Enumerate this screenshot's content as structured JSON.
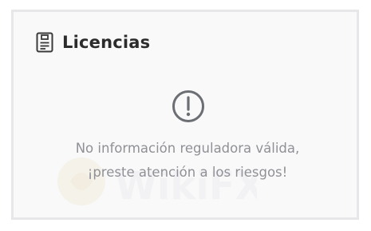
{
  "card": {
    "title": "Licencias",
    "icon": "license-document-icon",
    "alert_icon": "exclamation-circle-icon",
    "message_line1": "No información reguladora válida,",
    "message_line2": "¡preste atención a los riesgos!"
  },
  "watermark": {
    "text": "WikiFX"
  },
  "colors": {
    "card_background": "#f9f9fa",
    "card_border": "#e7e7ea",
    "title_text": "#2c2c2c",
    "message_text": "#8f9196",
    "icon_gray": "#6b6e73"
  }
}
